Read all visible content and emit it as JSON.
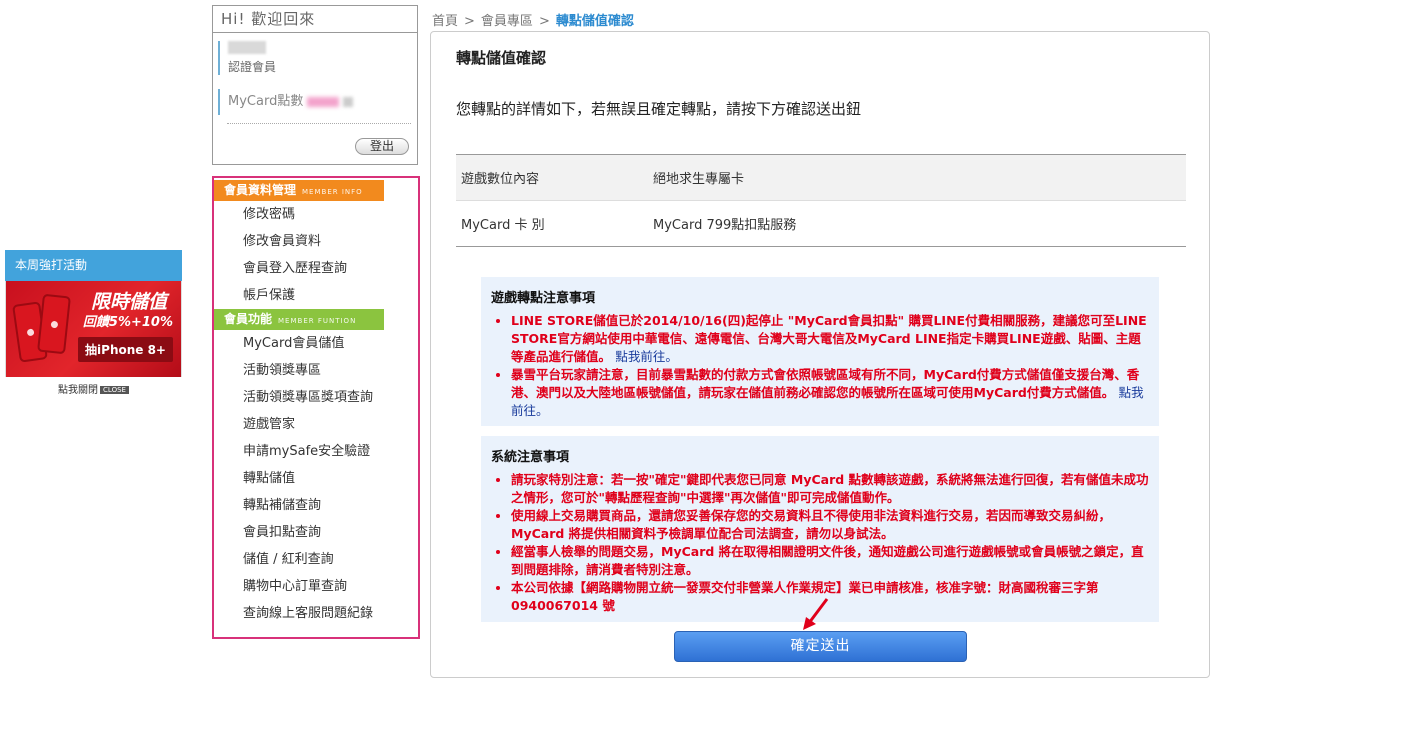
{
  "promo": {
    "header": "本周強打活動",
    "title": "限時儲值",
    "subtitle": "回饋5%+10%",
    "button": "抽iPhone 8+",
    "close_text": "點我關閉",
    "close_tag": "CLOSE"
  },
  "member": {
    "greeting": "Hi! 歡迎回來",
    "level": "認證會員",
    "points_label": "MyCard點數",
    "logout": "登出"
  },
  "menu": {
    "sections": [
      {
        "title": "會員資料管理",
        "title_en": "MEMBER INFO",
        "color": "#f28a1e",
        "items": [
          "修改密碼",
          "修改會員資料",
          "會員登入歷程查詢",
          "帳戶保護"
        ]
      },
      {
        "title": "會員功能",
        "title_en": "MEMBER FUNTION",
        "color": "#8bc43f",
        "items": [
          "MyCard會員儲值",
          "活動領獎專區",
          "活動領獎專區獎項查詢",
          "遊戲管家",
          "申請mySafe安全驗證",
          "轉點儲值",
          "轉點補儲查詢",
          "會員扣點查詢",
          "儲值 / 紅利查詢",
          "購物中心訂單查詢",
          "查詢線上客服問題紀錄"
        ]
      }
    ]
  },
  "breadcrumb": {
    "home": "首頁",
    "section": "會員專區",
    "current": "轉點儲值確認",
    "separator": ">"
  },
  "panel": {
    "title": "轉點儲值確認",
    "intro": "您轉點的詳情如下，若無誤且確定轉點，請按下方確認送出鈕",
    "rows": [
      {
        "label": "遊戲數位內容",
        "value": "絕地求生專屬卡"
      },
      {
        "label": "MyCard 卡 別",
        "value": "MyCard 799點扣點服務"
      }
    ]
  },
  "notice_game": {
    "title": "遊戲轉點注意事項",
    "items": [
      {
        "text": "LINE STORE儲值已於2014/10/16(四)起停止 \"MyCard會員扣點\" 購買LINE付費相關服務，建議您可至LINE STORE官方網站使用中華電信、遠傳電信、台灣大哥大電信及MyCard LINE指定卡購買LINE遊戲、貼圖、主題等產品進行儲值。",
        "link": "點我前往。"
      },
      {
        "text": "暴雪平台玩家請注意，目前暴雪點數的付款方式會依照帳號區域有所不同，MyCard付費方式儲值僅支援台灣、香港、澳門以及大陸地區帳號儲值，請玩家在儲值前務必確認您的帳號所在區域可使用MyCard付費方式儲值。",
        "link": "點我前往。"
      }
    ]
  },
  "notice_system": {
    "title": "系統注意事項",
    "items": [
      "請玩家特別注意：若一按\"確定\"鍵即代表您已同意 MyCard 點數轉該遊戲，系統將無法進行回復，若有儲值未成功之情形，您可於\"轉點歷程查詢\"中選擇\"再次儲值\"即可完成儲值動作。",
      "使用線上交易購買商品，還請您妥善保存您的交易資料且不得使用非法資料進行交易，若因而導致交易糾紛，MyCard 將提供相關資料予檢調單位配合司法調查，請勿以身試法。",
      "經當事人檢舉的問題交易，MyCard 將在取得相關證明文件後，通知遊戲公司進行遊戲帳號或會員帳號之鎖定，直到問題排除，請消費者特別注意。",
      "本公司依據【網路購物開立統一發票交付非營業人作業規定】業已申請核准，核准字號：財高國稅審三字第 0940067014 號"
    ]
  },
  "submit": {
    "label": "確定送出"
  },
  "colors": {
    "accent_blue": "#2d8bd0",
    "menu_border": "#d8317a",
    "notice_red": "#e0001b",
    "button_blue": "#3a7fe0"
  }
}
